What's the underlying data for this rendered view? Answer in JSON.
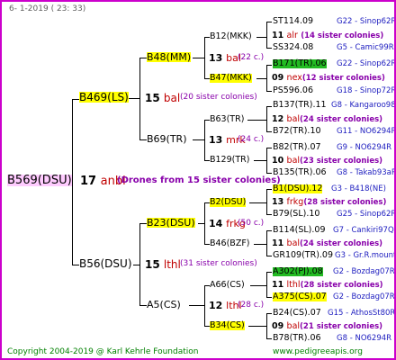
{
  "header": "6-  1-2019 ( 23: 33)",
  "footer": {
    "copyright": "Copyright 2004-2019 @ Karl Kehrle Foundation",
    "website": "www.pedigreeapis.org"
  },
  "root": {
    "label": "B569(DSU)",
    "num": "17",
    "place": "anbl",
    "note": "(Drones from 15 sister colonies)"
  },
  "gen2": [
    {
      "label": "B469(LS)",
      "num": "15",
      "place": "bal",
      "note": "(20 sister colonies)"
    },
    {
      "label": "B56(DSU)",
      "num": "15",
      "place": "lthl",
      "note": "(31 sister colonies)"
    }
  ],
  "gen3": [
    {
      "label": "B48(MM)",
      "num": "13",
      "place": "bal",
      "note": "(22 c.)"
    },
    {
      "label": "B69(TR)",
      "num": "13",
      "place": "mrk",
      "note": "(24 c.)"
    },
    {
      "label": "B23(DSU)",
      "num": "14",
      "place": "frkg",
      "note": "(50 c.)"
    },
    {
      "label": "A5(CS)",
      "num": "12",
      "place": "lthl",
      "note": "(28 c.)"
    }
  ],
  "gen4": [
    {
      "label": "B12(MKK)",
      "num": "11",
      "place": "alr",
      "note": "(14 sister colonies)"
    },
    {
      "label": "B47(MKK)",
      "num": "09",
      "place": "nex",
      "note": "(12 sister colonies)"
    },
    {
      "label": "B63(TR)",
      "num": "12",
      "place": "bal",
      "note": "(24 sister colonies)"
    },
    {
      "label": "B129(TR)",
      "num": "10",
      "place": "bal",
      "note": "(23 sister colonies)"
    },
    {
      "label": "B2(DSU)",
      "num": "13",
      "place": "frkg",
      "note": "(28 sister colonies)"
    },
    {
      "label": "B46(BZF)",
      "num": "11",
      "place": "bal",
      "note": "(24 sister colonies)"
    },
    {
      "label": "A66(CS)",
      "num": "11",
      "place": "lthl",
      "note": "(28 sister colonies)"
    },
    {
      "label": "B34(CS)",
      "num": "09",
      "place": "bal",
      "note": "(21 sister colonies)"
    }
  ],
  "gen5": [
    {
      "label": "ST114.09",
      "info": "G22 - Sinop62R"
    },
    {
      "label": "SS324.08",
      "info": "G5 - Camic99R"
    },
    {
      "label": "B171(TR).06",
      "info": "G22 - Sinop62R"
    },
    {
      "label": "PS596.06",
      "info": "G18 - Sinop72R"
    },
    {
      "label": "B137(TR).11",
      "info": "G8 - Kangaroo98R"
    },
    {
      "label": "B72(TR).10",
      "info": "G11 - NO6294R"
    },
    {
      "label": "B82(TR).07",
      "info": "G9 - NO6294R"
    },
    {
      "label": "B135(TR).06",
      "info": "G8 - Takab93aR"
    },
    {
      "label": "B1(DSU).12",
      "info": "G3 - B418(NE)"
    },
    {
      "label": "B79(SL).10",
      "info": "G25 - Sinop62R"
    },
    {
      "label": "B114(SL).09",
      "info": "G7 - Cankiri97Q"
    },
    {
      "label": "GR109(TR).09",
      "info": "G3 - Gr.R.mounta"
    },
    {
      "label": "A302(PJ).08",
      "info": "G2 - Bozdag07R"
    },
    {
      "label": "A375(CS).07",
      "info": "G2 - Bozdag07R"
    },
    {
      "label": "B24(CS).07",
      "info": "G15 - AthosSt80R"
    },
    {
      "label": "B78(TR).06",
      "info": "G8 - NO6294R"
    }
  ]
}
